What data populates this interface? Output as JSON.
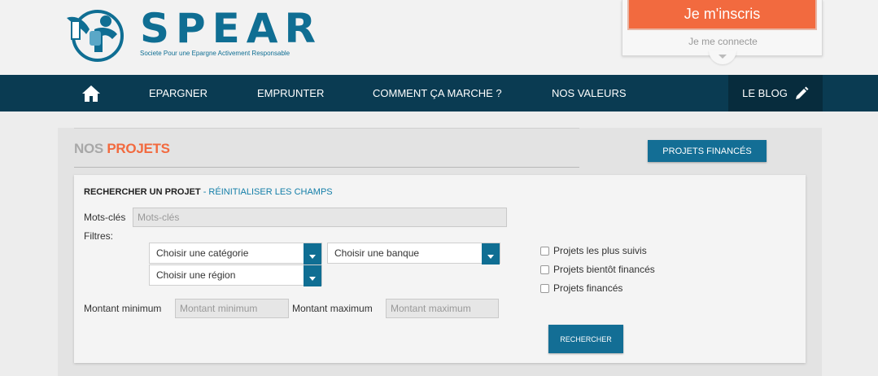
{
  "header": {
    "brand": "SPEAR",
    "tagline": "Societe Pour une Epargne Activement Responsable",
    "signup_label": "Je m'inscris",
    "login_label": "Je me connecte"
  },
  "nav": {
    "items": [
      "EPARGNER",
      "EMPRUNTER",
      "COMMENT ÇA MARCHE ?",
      "NOS VALEURS"
    ],
    "blog_label": "LE BLOG"
  },
  "projects": {
    "title_prefix": "NOS",
    "title_highlight": "PROJETS",
    "funded_button": "PROJETS FINANCÉS"
  },
  "search": {
    "heading": "RECHERCHER UN PROJET",
    "separator": " - ",
    "reset_link": "RÉINITIALISER LES CHAMPS",
    "keywords_label": "Mots-clés",
    "keywords_placeholder": "Mots-clés",
    "filters_label": "Filtres:",
    "category_select": "Choisir une catégorie",
    "bank_select": "Choisir une banque",
    "region_select": "Choisir une région",
    "min_label": "Montant minimum",
    "min_placeholder": "Montant minimum",
    "max_label": "Montant maximum",
    "max_placeholder": "Montant maximum",
    "checkboxes": [
      "Projets les plus suivis",
      "Projets bientôt financés",
      "Projets financés"
    ],
    "submit_label": "RECHERCHER"
  },
  "colors": {
    "navbar": "#0a3b52",
    "accent_orange": "#f26a3f",
    "primary_blue": "#136e95"
  }
}
